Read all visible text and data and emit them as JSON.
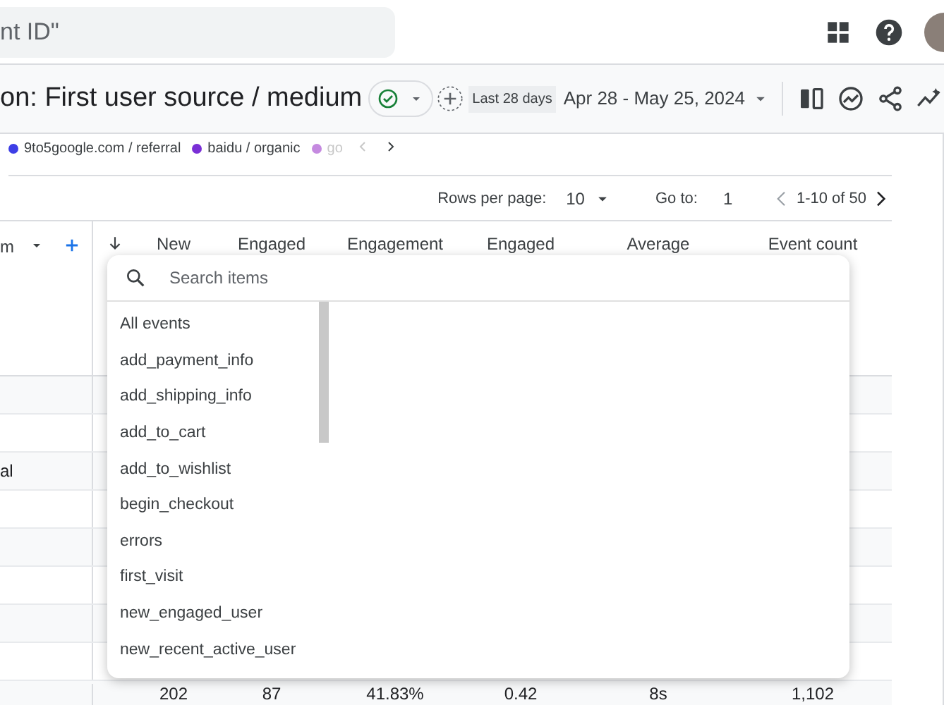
{
  "top_bar": {
    "search_placeholder": "nt ID\""
  },
  "header": {
    "title": "on: First user source / medium",
    "date_label": "Last 28 days",
    "date_range": "Apr 28 - May 25, 2024"
  },
  "legend": [
    {
      "label": "9to5google.com / referral",
      "color": "#3d3ee6"
    },
    {
      "label": "baidu / organic",
      "color": "#7a2fd6"
    },
    {
      "label": "go",
      "color": "#c58ae0"
    }
  ],
  "pagination": {
    "rows_per_page_label": "Rows per page:",
    "rows_per_page_value": "10",
    "goto_label": "Go to:",
    "goto_value": "1",
    "range": "1-10 of 50"
  },
  "table": {
    "first_column_header": "m",
    "columns": [
      "New",
      "Engaged",
      "Engagement",
      "Engaged",
      "Average",
      "Event count"
    ],
    "rows": [
      {},
      {},
      {
        "label": "al"
      },
      {},
      {},
      {},
      {},
      {},
      {
        "values": [
          "202",
          "87",
          "41.83%",
          "0.42",
          "8s",
          "1,102"
        ]
      }
    ]
  },
  "dropdown": {
    "search_placeholder": "Search items",
    "items": [
      "All events",
      "add_payment_info",
      "add_shipping_info",
      "add_to_cart",
      "add_to_wishlist",
      "begin_checkout",
      "errors",
      "first_visit",
      "new_engaged_user",
      "new_recent_active_user"
    ]
  }
}
